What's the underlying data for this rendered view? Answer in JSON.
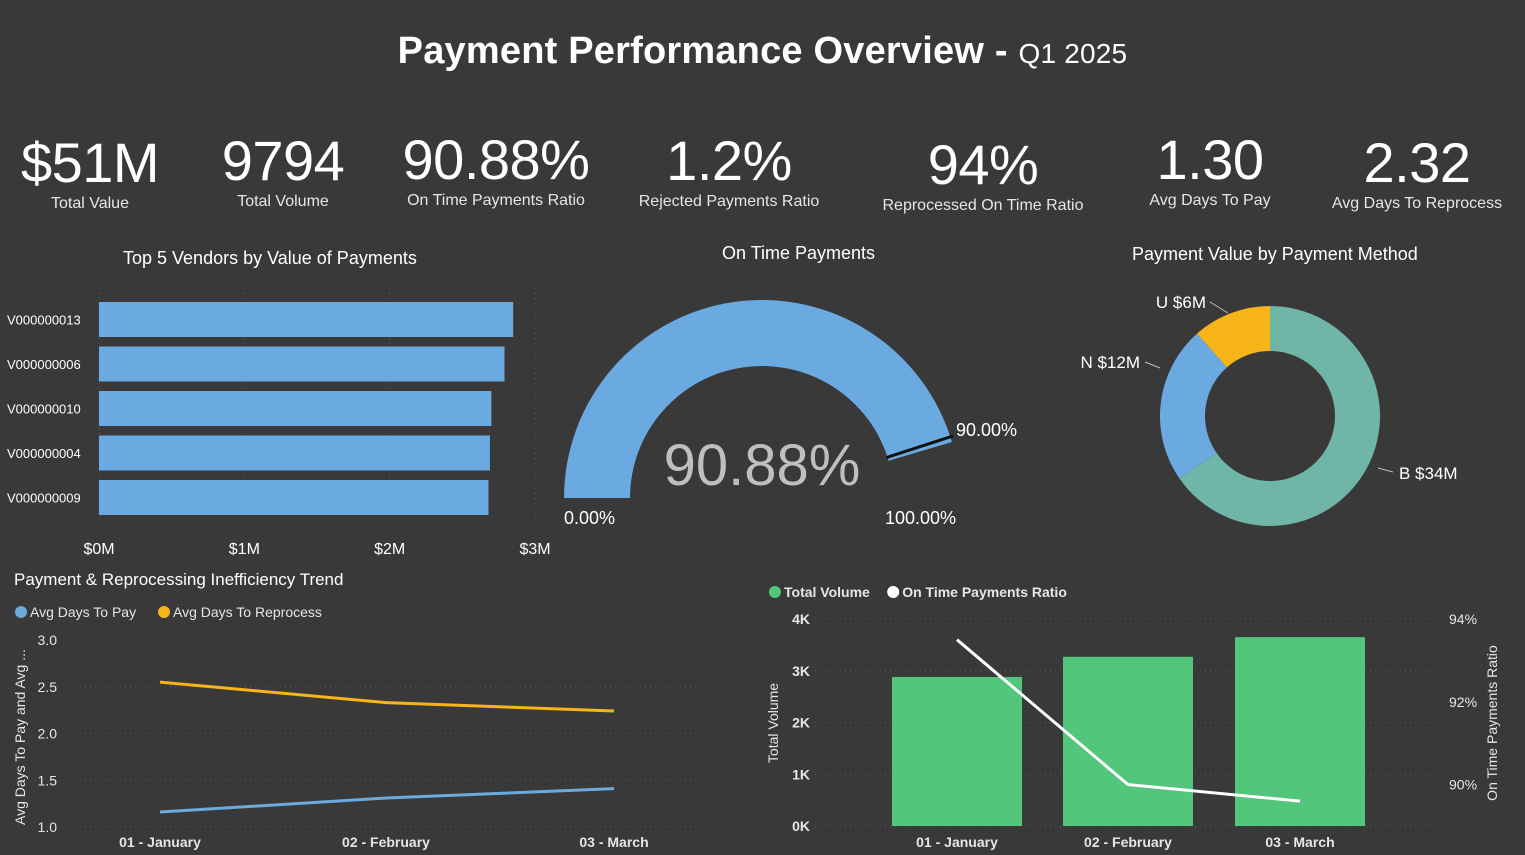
{
  "title": "Payment Performance Overview -",
  "subtitle": "Q1 2025",
  "kpis": [
    {
      "value": "$51M",
      "label": "Total Value"
    },
    {
      "value": "9794",
      "label": "Total Volume"
    },
    {
      "value": "90.88%",
      "label": "On Time Payments Ratio"
    },
    {
      "value": "1.2%",
      "label": "Rejected Payments Ratio"
    },
    {
      "value": "94%",
      "label": "Reprocessed On Time Ratio"
    },
    {
      "value": "1.30",
      "label": "Avg Days To Pay"
    },
    {
      "value": "2.32",
      "label": "Avg Days To Reprocess"
    }
  ],
  "colors": {
    "background": "#393939",
    "bar_blue": "#6aaae0",
    "gauge_blue": "#6aaae0",
    "donut_teal": "#6fb5a8",
    "donut_blue": "#6aaae0",
    "donut_yellow": "#f8b519",
    "line_blue": "#6aaae0",
    "line_yellow": "#f8b519",
    "combo_green": "#52c67a",
    "combo_line": "#ffffff"
  },
  "charts": {
    "vendors": {
      "title": "Top 5 Vendors by Value of Payments",
      "chart_data": {
        "type": "bar",
        "orientation": "horizontal",
        "categories": [
          "V000000013",
          "V000000006",
          "V000000010",
          "V000000004",
          "V000000009"
        ],
        "values": [
          2.85,
          2.79,
          2.7,
          2.69,
          2.68
        ],
        "xlim": [
          0,
          3
        ],
        "ticks": [
          0,
          1,
          2,
          3
        ],
        "tick_labels": [
          "$0M",
          "$1M",
          "$2M",
          "$3M"
        ]
      }
    },
    "gauge": {
      "title": "On Time Payments",
      "chart_data": {
        "type": "gauge",
        "value": 90.88,
        "value_label": "90.88%",
        "min": 0,
        "min_label": "0.00%",
        "max": 100,
        "max_label": "100.00%",
        "target": 90,
        "target_label": "90.00%"
      }
    },
    "donut": {
      "title": "Payment Value by Payment Method",
      "chart_data": {
        "type": "pie",
        "hole": true,
        "slices": [
          {
            "label": "B $34M",
            "value": 34,
            "color": "#6fb5a8"
          },
          {
            "label": "N $12M",
            "value": 12,
            "color": "#6aaae0"
          },
          {
            "label": "U $6M",
            "value": 6,
            "color": "#f8b519"
          }
        ]
      }
    },
    "trend": {
      "title": "Payment & Reprocessing Inefficiency Trend",
      "chart_data": {
        "type": "line",
        "categories": [
          "01 - January",
          "02 - February",
          "03 - March"
        ],
        "ylabel": "Avg Days To Pay and Avg ...",
        "ylim": [
          1.0,
          3.0
        ],
        "yticks": [
          "1.0",
          "1.5",
          "2.0",
          "2.5",
          "3.0"
        ],
        "series": [
          {
            "name": "Avg Days To Pay",
            "values": [
              1.16,
              1.31,
              1.41
            ],
            "color": "#6aaae0"
          },
          {
            "name": "Avg Days To Reprocess",
            "values": [
              2.55,
              2.33,
              2.24
            ],
            "color": "#f8b519"
          }
        ]
      }
    },
    "combo": {
      "chart_data": {
        "type": "bar",
        "categories": [
          "01 - January",
          "02 - February",
          "03 - March"
        ],
        "series": [
          {
            "name": "Total Volume",
            "values": [
              2880,
              3270,
              3650
            ],
            "color": "#52c67a",
            "axis": "left"
          },
          {
            "name": "On Time Payments Ratio",
            "values": [
              93.5,
              90.0,
              89.6
            ],
            "color": "#ffffff",
            "axis": "right"
          }
        ],
        "ylabel": "Total Volume",
        "ylim": [
          0,
          4000
        ],
        "yticks": [
          "0K",
          "1K",
          "2K",
          "3K",
          "4K"
        ],
        "y2label": "On Time Payments Ratio",
        "y2lim": [
          89,
          94
        ],
        "y2ticks": [
          {
            "v": 90,
            "t": "90%"
          },
          {
            "v": 92,
            "t": "92%"
          },
          {
            "v": 94,
            "t": "94%"
          }
        ]
      }
    }
  }
}
